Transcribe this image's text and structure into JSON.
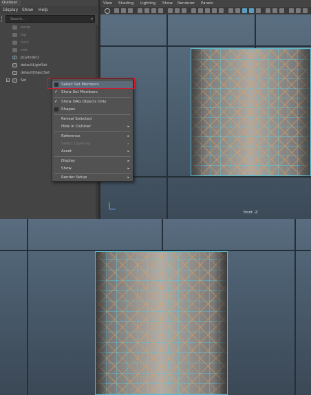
{
  "outliner": {
    "tab_label": "Outliner",
    "menu": [
      "Display",
      "Show",
      "Help"
    ],
    "search_placeholder": "Search...",
    "items": [
      {
        "label": "persp",
        "icon": "camera-icon",
        "dim": true
      },
      {
        "label": "top",
        "icon": "camera-icon",
        "dim": true
      },
      {
        "label": "front",
        "icon": "camera-icon",
        "dim": true
      },
      {
        "label": "side",
        "icon": "camera-icon",
        "dim": true
      },
      {
        "label": "pCylinder1",
        "icon": "mesh-icon",
        "dim": false
      },
      {
        "label": "defaultLightSet",
        "icon": "set-icon",
        "dim": false
      },
      {
        "label": "defaultObjectSet",
        "icon": "set-icon",
        "dim": false
      },
      {
        "label": "Set",
        "icon": "set-icon",
        "dim": false
      }
    ]
  },
  "viewport_top": {
    "menu": [
      "View",
      "Shading",
      "Lighting",
      "Show",
      "Renderer",
      "Panels"
    ],
    "camera_label": "front -Z"
  },
  "context_menu": {
    "items": [
      {
        "label": "Select Set Members",
        "highlighted": true,
        "check": "box"
      },
      {
        "label": "Show Set Members",
        "check": "check"
      },
      {
        "sep": true
      },
      {
        "label": "Show DAG Objects Only",
        "check": "check"
      },
      {
        "label": "Shapes",
        "check": "box"
      },
      {
        "sep": true
      },
      {
        "label": "Reveal Selected"
      },
      {
        "label": "Hide In Outliner",
        "submenu": true
      },
      {
        "sep": true
      },
      {
        "label": "Reference",
        "submenu": true
      },
      {
        "label": "Select Layering",
        "disabled": true,
        "submenu": true
      },
      {
        "label": "Asset",
        "submenu": true
      },
      {
        "sep": true
      },
      {
        "label": "Display",
        "submenu": true
      },
      {
        "label": "Show",
        "submenu": true
      },
      {
        "sep": true
      },
      {
        "label": "Render Setup",
        "submenu": true
      }
    ]
  },
  "colors": {
    "highlight_box": "#d8192a",
    "wireframe": "#5fb8c9",
    "menu_highlight": "#5c6a79"
  }
}
